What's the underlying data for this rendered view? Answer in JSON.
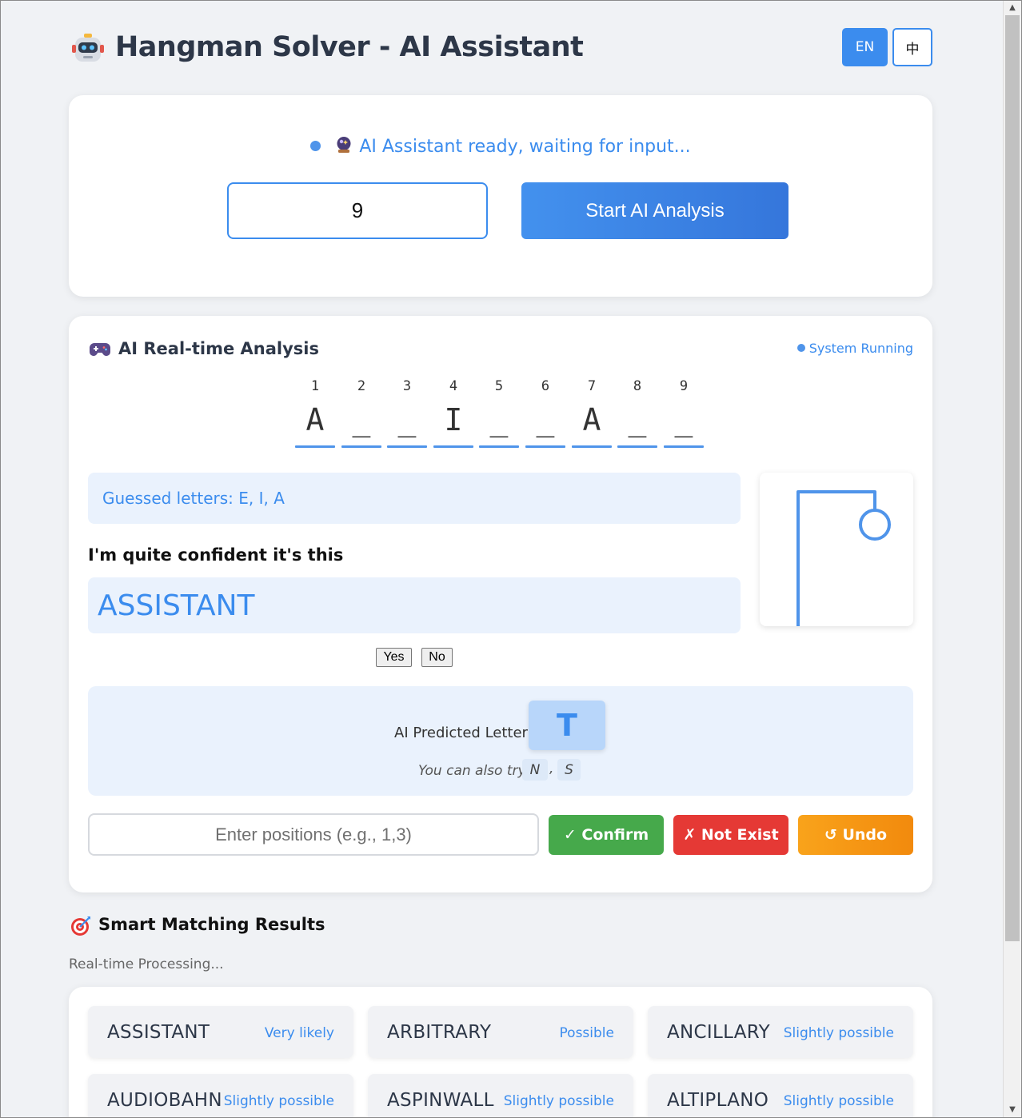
{
  "header": {
    "logo_icon": "robot-icon",
    "title": "Hangman Solver - AI Assistant",
    "lang_en": "EN",
    "lang_zh": "中"
  },
  "setup": {
    "status_icon": "crystal-ball-icon",
    "status": "AI Assistant ready, waiting for input...",
    "length_value": "9",
    "start_label": "Start AI Analysis"
  },
  "analysis": {
    "title_icon": "gamepad-icon",
    "title": "AI Real-time Analysis",
    "system_status": "System Running",
    "slots": [
      {
        "num": "1",
        "char": "A"
      },
      {
        "num": "2",
        "char": "_"
      },
      {
        "num": "3",
        "char": "_"
      },
      {
        "num": "4",
        "char": "I"
      },
      {
        "num": "5",
        "char": "_"
      },
      {
        "num": "6",
        "char": "_"
      },
      {
        "num": "7",
        "char": "A"
      },
      {
        "num": "8",
        "char": "_"
      },
      {
        "num": "9",
        "char": "_"
      }
    ],
    "guessed": "Guessed letters: E, I, A",
    "confident_label": "I'm quite confident it's this",
    "guess_word": "ASSISTANT",
    "yes_label": "Yes",
    "no_label": "No",
    "predict_label": "AI Predicted Letter:",
    "predicted_letter": "T",
    "also_label": "You can also try:",
    "alternatives": [
      "N",
      "S"
    ],
    "alt_separator": ",",
    "positions_placeholder": "Enter positions (e.g., 1,3)",
    "confirm_label": "✓ Confirm",
    "not_exist_label": "✗ Not Exist",
    "undo_label": "↺ Undo"
  },
  "results": {
    "title_icon": "target-icon",
    "title": "Smart Matching Results",
    "processing": "Real-time Processing...",
    "words": [
      {
        "word": "ASSISTANT",
        "prob": "Very likely"
      },
      {
        "word": "ARBITRARY",
        "prob": "Possible"
      },
      {
        "word": "ANCILLARY",
        "prob": "Slightly possible"
      },
      {
        "word": "AUDIOBAHN",
        "prob": "Slightly possible"
      },
      {
        "word": "ASPINWALL",
        "prob": "Slightly possible"
      },
      {
        "word": "ALTIPLANO",
        "prob": "Slightly possible"
      }
    ]
  },
  "colors": {
    "accent": "#3b8cee",
    "confirm": "#46a94b",
    "not_exist": "#e53935",
    "undo": "#f28a0d",
    "light_panel": "#eaf2fd"
  }
}
